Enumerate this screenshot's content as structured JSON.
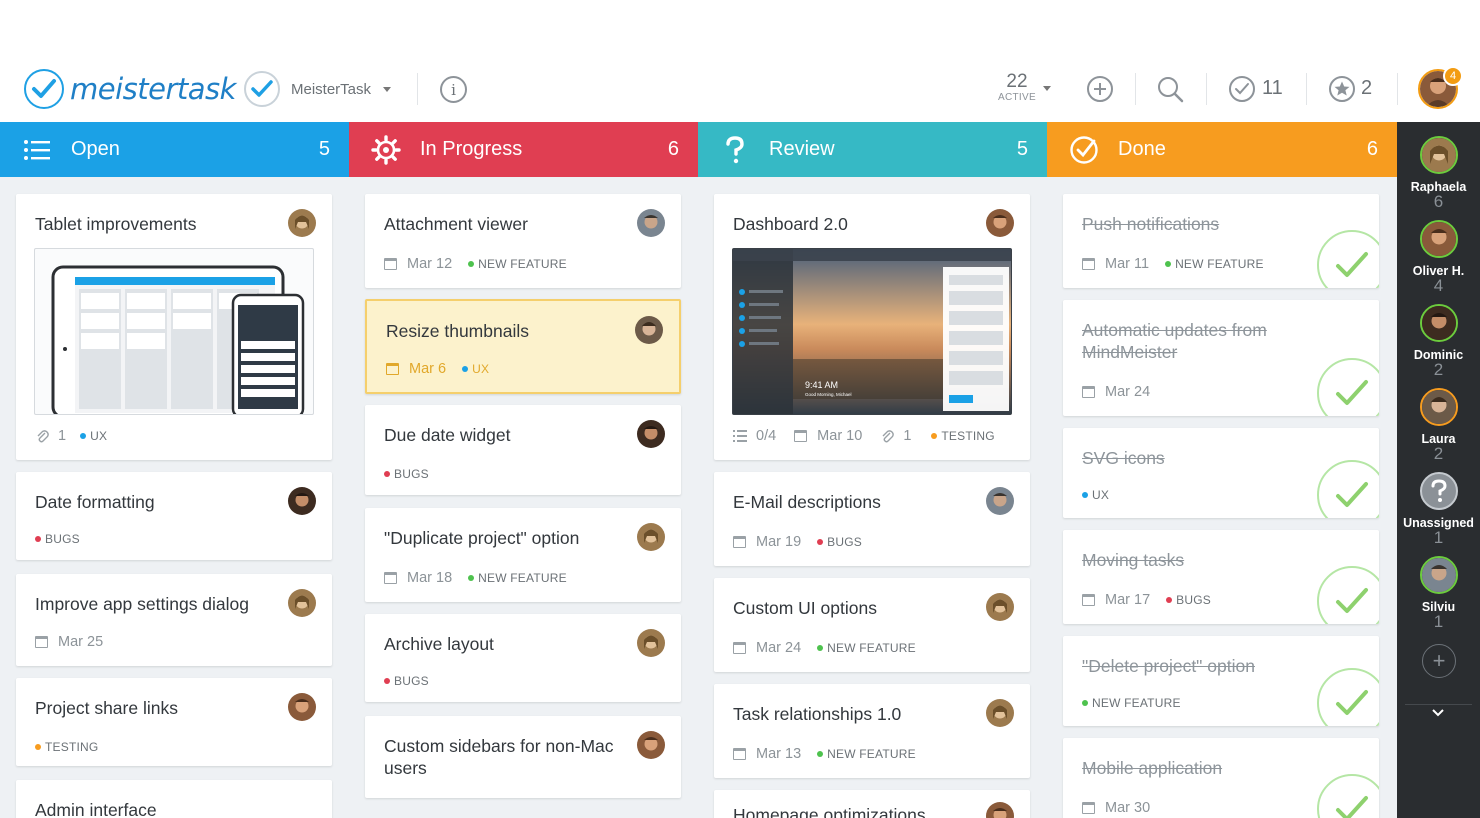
{
  "app": {
    "logo_text": "meistertask",
    "project_name": "MeisterTask"
  },
  "toolbar": {
    "active_count": "22",
    "active_label": "ACTIVE",
    "checked_count": "11",
    "starred_count": "2",
    "notifications": "4"
  },
  "colors": {
    "open": "#1ba1e6",
    "in_progress": "#e03e52",
    "review": "#36b9c5",
    "done": "#f79c1f",
    "bugs": "#e03e52",
    "ux": "#1ba1e6",
    "new_feature": "#4ec24e",
    "testing": "#f79c1f"
  },
  "columns": [
    {
      "title": "Open",
      "count": "5",
      "icon": "list-icon",
      "cards": [
        {
          "title": "Tablet improvements",
          "attachments": "1",
          "tag": "UX"
        },
        {
          "title": "Date formatting",
          "tag": "BUGS"
        },
        {
          "title": "Improve app settings dialog",
          "date": "Mar 25"
        },
        {
          "title": "Project share links",
          "tag": "TESTING"
        },
        {
          "title": "Admin interface"
        }
      ]
    },
    {
      "title": "In Progress",
      "count": "6",
      "icon": "gear-icon",
      "cards": [
        {
          "title": "Attachment viewer",
          "date": "Mar 12",
          "tag": "NEW FEATURE"
        },
        {
          "title": "Resize thumbnails",
          "date": "Mar 6",
          "tag": "UX"
        },
        {
          "title": "Due date widget",
          "tag": "BUGS"
        },
        {
          "title": "\"Duplicate project\" option",
          "date": "Mar 18",
          "tag": "NEW FEATURE"
        },
        {
          "title": "Archive layout",
          "tag": "BUGS"
        },
        {
          "title": "Custom sidebars for non-Mac users"
        }
      ]
    },
    {
      "title": "Review",
      "count": "5",
      "icon": "question-icon",
      "cards": [
        {
          "title": "Dashboard 2.0",
          "checklist": "0/4",
          "date": "Mar 10",
          "attachments": "1",
          "tag": "TESTING"
        },
        {
          "title": "E-Mail descriptions",
          "date": "Mar 19",
          "tag": "BUGS"
        },
        {
          "title": "Custom UI options",
          "date": "Mar 24",
          "tag": "NEW FEATURE"
        },
        {
          "title": "Task relationships 1.0",
          "date": "Mar 13",
          "tag": "NEW FEATURE"
        },
        {
          "title": "Homepage optimizations"
        }
      ]
    },
    {
      "title": "Done",
      "count": "6",
      "icon": "check-circle-icon",
      "cards": [
        {
          "title": "Push notifications",
          "date": "Mar 11",
          "tag": "NEW FEATURE"
        },
        {
          "title": "Automatic updates from MindMeister",
          "date": "Mar 24"
        },
        {
          "title": "SVG icons",
          "tag": "UX"
        },
        {
          "title": "Moving tasks",
          "date": "Mar 17",
          "tag": "BUGS"
        },
        {
          "title": "\"Delete project\" option",
          "tag": "NEW FEATURE"
        },
        {
          "title": "Mobile application",
          "date": "Mar 30"
        }
      ]
    }
  ],
  "sidebar": {
    "users": [
      {
        "name": "Raphaela",
        "count": "6"
      },
      {
        "name": "Oliver H.",
        "count": "4"
      },
      {
        "name": "Dominic",
        "count": "2"
      },
      {
        "name": "Laura",
        "count": "2"
      },
      {
        "name": "Unassigned",
        "count": "1"
      },
      {
        "name": "Silviu",
        "count": "1"
      }
    ]
  },
  "thumbnail": {
    "screen_time": "9:41 AM",
    "screen_greeting": "Good Morning, Michael"
  }
}
